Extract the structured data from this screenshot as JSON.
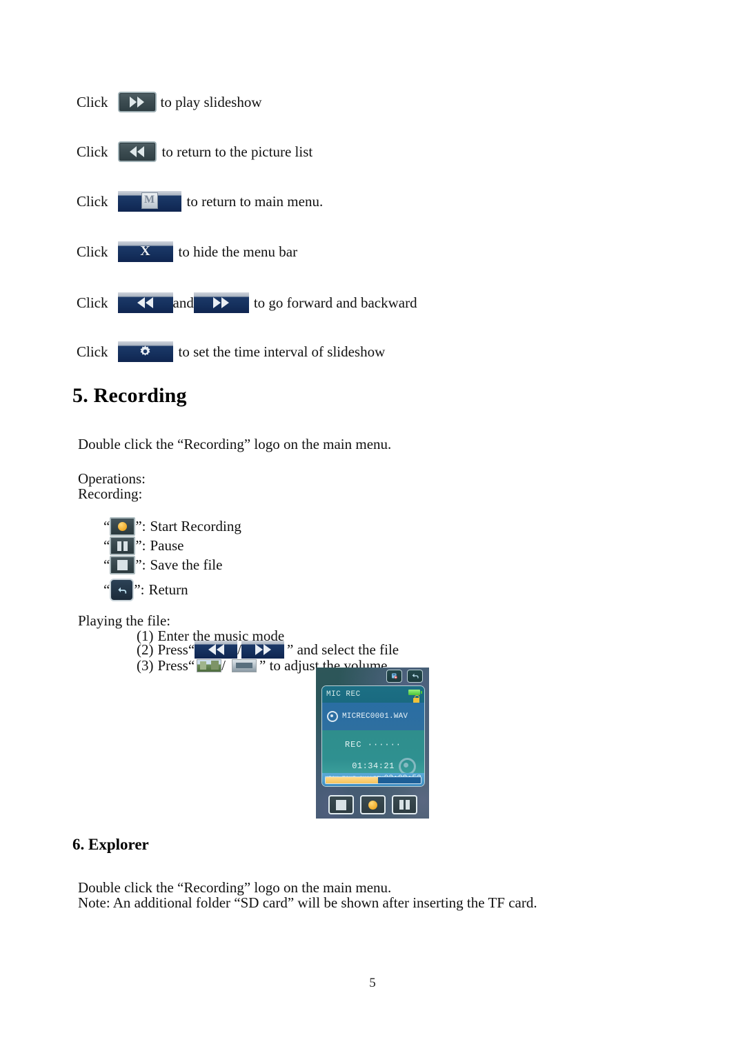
{
  "document": {
    "page_number": "5"
  },
  "instructions": [
    {
      "prefix": "Click",
      "icon": "fast-forward-button",
      "suffix": "to play slideshow"
    },
    {
      "prefix": "Click",
      "icon": "rewind-button",
      "suffix": "to return to the picture list"
    },
    {
      "prefix": "Click",
      "icon": "main-menu-button",
      "suffix": "to return to main menu."
    },
    {
      "prefix": "Click",
      "icon": "close-button",
      "suffix": "to hide the menu bar"
    },
    {
      "prefix": "Click",
      "icon": "previous-button",
      "middle": "and",
      "icon2": "next-button",
      "suffix": "to go forward and backward"
    },
    {
      "prefix": "Click",
      "icon": "settings-gear-button",
      "suffix": "to set the time interval of slideshow"
    }
  ],
  "section_recording": {
    "heading": "5. Recording",
    "intro": "Double click the “Recording” logo on the main menu.",
    "operations_label": "Operations:",
    "recording_label": "Recording:",
    "ops": [
      {
        "open_quote": "“",
        "close_quote": "”:",
        "icon": "record-icon",
        "label": "Start Recording"
      },
      {
        "open_quote": "“",
        "close_quote": "”:",
        "icon": "pause-icon",
        "label": "Pause"
      },
      {
        "open_quote": "“",
        "close_quote": "”:",
        "icon": "stop-save-icon",
        "label": "Save the file"
      },
      {
        "open_quote": "“",
        "close_quote": "”:",
        "icon": "return-icon",
        "label": "Return"
      }
    ],
    "playing_label": "Playing the file:",
    "steps": [
      {
        "num": "(1)",
        "text": "Enter the music mode"
      },
      {
        "num": "(2)",
        "pre": "Press“",
        "sep": "/",
        "post": "” and select the file",
        "icon1": "rewind-icon",
        "icon2": "fast-forward-icon"
      },
      {
        "num": "(3)",
        "pre": "Press“",
        "sep": "/",
        "post": "” to adjust the volume",
        "icon1": "volume-up-thumbnail",
        "icon2": "volume-down-thumbnail"
      }
    ]
  },
  "device_screen": {
    "top_buttons": [
      "settings-icon",
      "return-icon"
    ],
    "title": "MIC REC",
    "battery": "battery-full-icon",
    "lock": "lock-icon",
    "file_icon": "disc-icon",
    "file_name": "MICREC0001.WAV",
    "status_text": "REC ······",
    "elapsed_time": "01:34:21",
    "quality_label": "HIGH TONE QUALITY",
    "total_time": "02:08:53",
    "progress_percent": 55,
    "controls": [
      "stop-button",
      "record-button",
      "pause-button"
    ],
    "colors": {
      "title_band": "#1a6a80",
      "file_band": "#2e6fa0",
      "status_band": "#2f9090",
      "info_band": "#4f9ecd",
      "progress_fill": "#f6c35b",
      "record_dot": "#f0ab27"
    }
  },
  "section_explorer": {
    "heading": "6. Explorer",
    "line1": "Double click the “Recording” logo on the main menu.",
    "line2": "Note: An additional folder “SD card” will be shown after inserting the TF card."
  }
}
